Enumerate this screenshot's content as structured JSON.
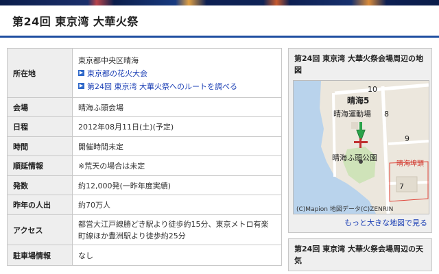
{
  "page": {
    "title": "第24回 東京湾 大華火祭"
  },
  "info_rows": [
    {
      "label": "所在地",
      "value": "東京都中央区晴海"
    },
    {
      "label": "会場",
      "value": "晴海ふ頭会場"
    },
    {
      "label": "日程",
      "value": "2012年08月11日(土)(予定)"
    },
    {
      "label": "時間",
      "value": "開催時間未定"
    },
    {
      "label": "順延情報",
      "value": "※荒天の場合は未定"
    },
    {
      "label": "発数",
      "value": "約12,000発(一昨年度実績)"
    },
    {
      "label": "昨年の人出",
      "value": "約70万人"
    },
    {
      "label": "アクセス",
      "value": "都営大江戸線勝どき駅より徒歩約15分、東京メトロ有楽町線ほか豊洲駅より徒歩約25分"
    },
    {
      "label": "駐車場情報",
      "value": "なし"
    }
  ],
  "links": [
    {
      "label": "東京都の花火大会"
    },
    {
      "label": "第24回 東京湾 大華火祭へのルートを調べる"
    }
  ],
  "map_box": {
    "title": "第24回 東京湾 大華火祭会場周辺の地図",
    "labels": {
      "area": "晴海5",
      "venue1": "晴海運動場",
      "park": "晴海ふ頭公園",
      "pier": "晴海埠頭",
      "n10": "10",
      "n8": "8",
      "n9": "9",
      "n7": "7"
    },
    "copyright": "(C)Mapion  地図データ(C)ZENRIN",
    "more_link": "もっと大きな地図で見る"
  },
  "weather_box": {
    "title": "第24回 東京湾 大華火祭会場周辺の天気"
  }
}
